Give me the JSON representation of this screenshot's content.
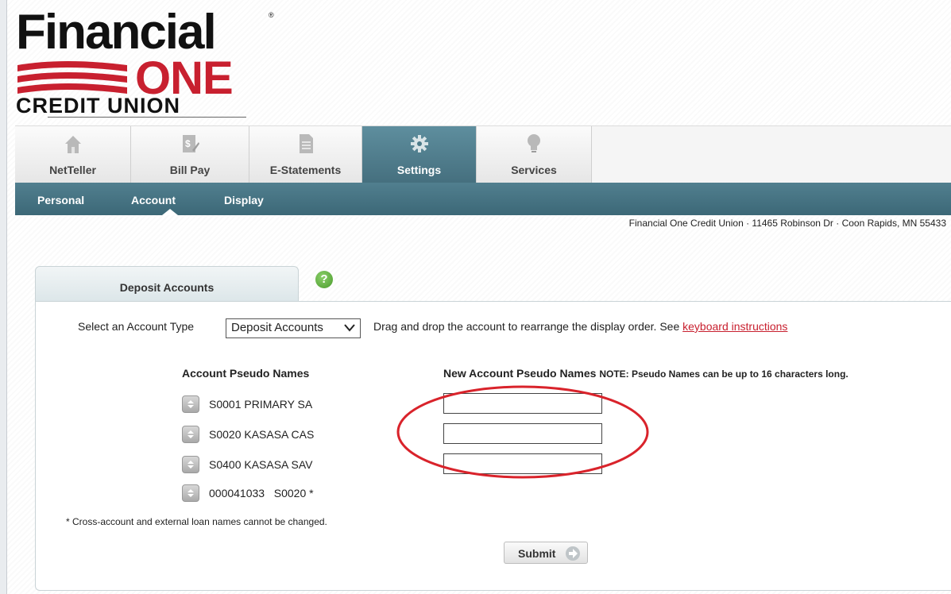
{
  "logo": {
    "line1": "Financial",
    "line2": "ONE",
    "line3": "CREDIT  UNION",
    "registered": "®"
  },
  "tabs": [
    {
      "label": "NetTeller",
      "icon": "home-icon"
    },
    {
      "label": "Bill Pay",
      "icon": "bill-pay-icon"
    },
    {
      "label": "E-Statements",
      "icon": "document-icon"
    },
    {
      "label": "Settings",
      "icon": "gear-icon",
      "active": true
    },
    {
      "label": "Services",
      "icon": "lightbulb-icon"
    }
  ],
  "subnav": [
    "Personal",
    "Account",
    "Display"
  ],
  "address": "Financial One Credit Union · 11465 Robinson Dr · Coon Rapids, MN 55433",
  "panel": {
    "tab_label": "Deposit Accounts",
    "help_icon": "?",
    "select_label": "Select an Account Type",
    "select_value": "Deposit Accounts",
    "drag_text": "Drag and drop the account to rearrange the display order. See ",
    "drag_link": "keyboard instructions",
    "col1_header": "Account Pseudo Names",
    "col2_header": "New Account Pseudo Names",
    "col2_note": "NOTE: Pseudo Names can be up to 16 characters long.",
    "accounts": [
      "S0001 PRIMARY SA",
      "S0020 KASASA CAS",
      "S0400 KASASA SAV",
      "000041033   S0020 *"
    ],
    "new_names": [
      "",
      "",
      ""
    ],
    "footnote": "* Cross-account and external loan names cannot be changed.",
    "submit_label": "Submit"
  },
  "colors": {
    "accent_red": "#c8202f",
    "tab_active": "#517f8f",
    "annotation": "#d9232b"
  }
}
